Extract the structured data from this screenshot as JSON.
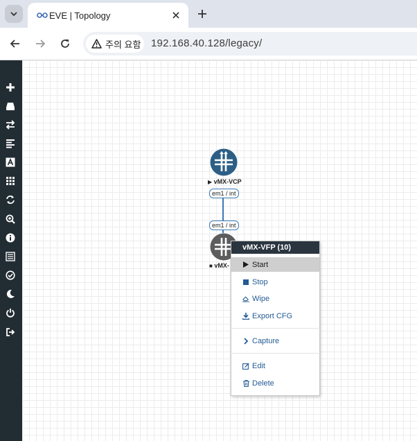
{
  "browser": {
    "tab_title": "EVE | Topology",
    "security_label": "주의 요함",
    "url": "192.168.40.128/legacy/"
  },
  "sidebar": {
    "icons": [
      "add-icon",
      "drive-icon",
      "exchange-icon",
      "align-left-icon",
      "text-font-icon",
      "grid-icon",
      "refresh-icon",
      "zoom-in-icon",
      "info-icon",
      "list-icon",
      "check-circle-icon",
      "moon-icon",
      "power-icon",
      "logout-icon"
    ]
  },
  "topology": {
    "nodes": [
      {
        "name": "vMX-VCP",
        "status_symbol": "▶",
        "color": "#2d5f86"
      },
      {
        "name": "vMX-",
        "status_symbol": "■",
        "color": "#5d5d5d"
      }
    ],
    "interfaces": [
      "em1 / int",
      "em1 / int"
    ]
  },
  "context_menu": {
    "title": "vMX-VFP (10)",
    "items": [
      {
        "label": "Start",
        "icon": "play-icon"
      },
      {
        "label": "Stop",
        "icon": "stop-icon"
      },
      {
        "label": "Wipe",
        "icon": "eraser-icon"
      },
      {
        "label": "Export CFG",
        "icon": "download-icon"
      },
      {
        "label": "Capture",
        "icon": "chevron-right-icon"
      },
      {
        "label": "Edit",
        "icon": "edit-icon"
      },
      {
        "label": "Delete",
        "icon": "trash-icon"
      }
    ]
  },
  "colors": {
    "sidebar_bg": "#222c33",
    "menu_header_bg": "#2b3540",
    "menu_text": "#245b94",
    "link": "#3a78b4"
  }
}
